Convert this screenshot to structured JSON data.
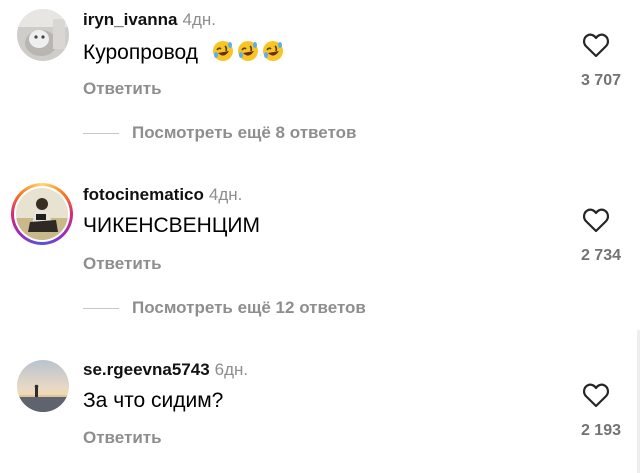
{
  "comments": [
    {
      "username": "iryn_ivanna",
      "time": "4дн.",
      "text": "Куропровод",
      "emoji_icon": "rolling-on-floor-laughing-face",
      "emoji_count": 3,
      "reply_label": "Ответить",
      "likes": "3 707",
      "view_more": "Посмотреть ещё 8 ответов"
    },
    {
      "username": "fotocinematico",
      "time": "4дн.",
      "text": "ЧИКЕНСВЕНЦИМ",
      "reply_label": "Ответить",
      "likes": "2 734",
      "view_more": "Посмотреть ещё 12 ответов"
    },
    {
      "username": "se.rgeevna5743",
      "time": "6дн.",
      "text": "За что сидим?",
      "reply_label": "Ответить",
      "likes": "2 193"
    }
  ],
  "icons": {
    "like": "heart-outline-icon"
  },
  "colors": {
    "secondary_text": "#8e8e8e",
    "like_count": "#737373",
    "divider": "#c7c7c7"
  }
}
